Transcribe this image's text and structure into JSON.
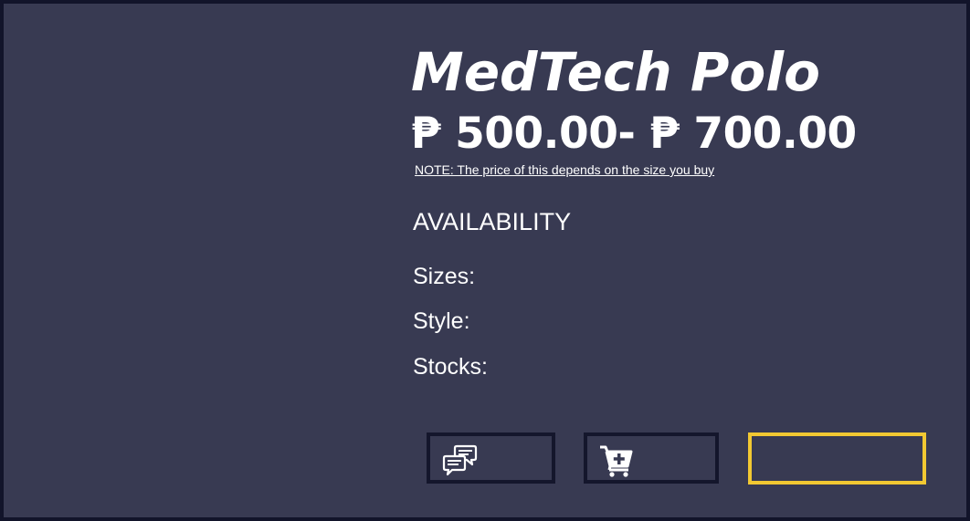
{
  "product": {
    "title": "MedTech Polo",
    "price_range": "₱ 500.00- ₱ 700.00",
    "note": "NOTE: The price of this depends on the size you buy"
  },
  "availability": {
    "heading": "AVAILABILITY",
    "sizes_label": "Sizes:",
    "style_label": "Style:",
    "stocks_label": "Stocks:"
  },
  "actions": {
    "chat_icon": "chat-bubbles-icon",
    "cart_icon": "add-to-cart-icon",
    "accent_color": "#f2c832"
  },
  "colors": {
    "panel_background": "#383a52",
    "frame_border": "#12142a",
    "text": "#ffffff"
  }
}
